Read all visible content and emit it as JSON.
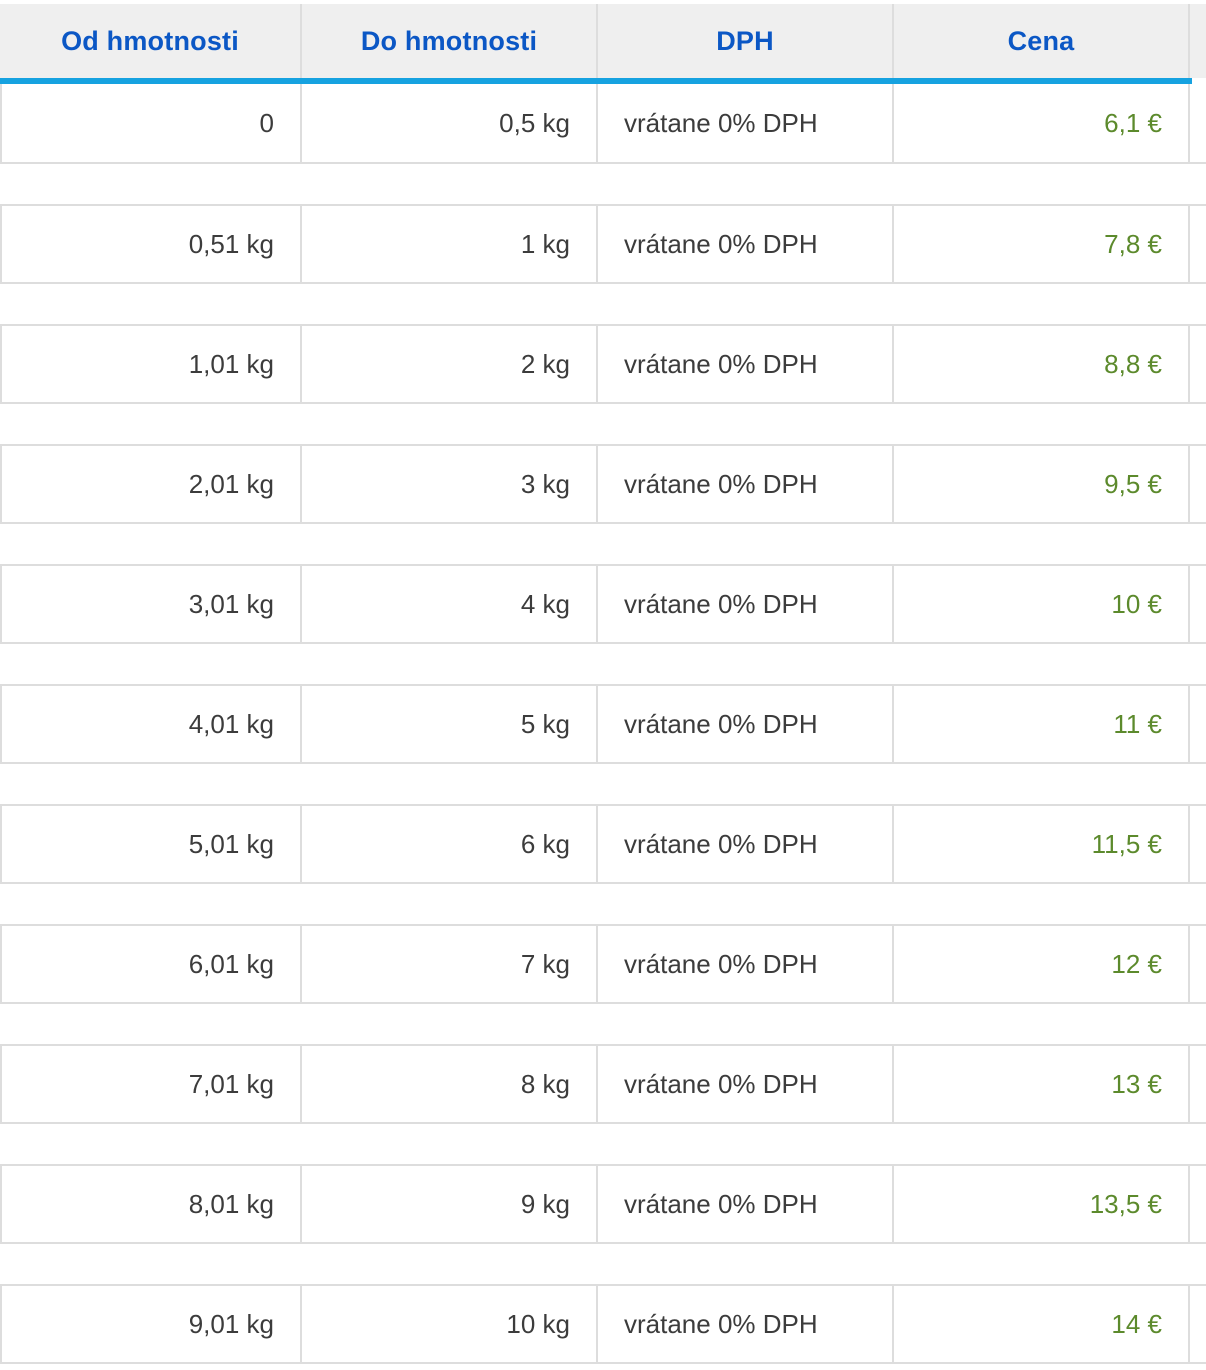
{
  "table": {
    "headers": [
      "Od hmotnosti",
      "Do hmotnosti",
      "DPH",
      "Cena"
    ],
    "rows": [
      {
        "from": "0",
        "to": "0,5 kg",
        "vat": "vrátane 0% DPH",
        "price": "6,1 €"
      },
      {
        "from": "0,51 kg",
        "to": "1 kg",
        "vat": "vrátane 0% DPH",
        "price": "7,8 €"
      },
      {
        "from": "1,01 kg",
        "to": "2 kg",
        "vat": "vrátane 0% DPH",
        "price": "8,8 €"
      },
      {
        "from": "2,01 kg",
        "to": "3 kg",
        "vat": "vrátane 0% DPH",
        "price": "9,5 €"
      },
      {
        "from": "3,01 kg",
        "to": "4 kg",
        "vat": "vrátane 0% DPH",
        "price": "10 €"
      },
      {
        "from": "4,01 kg",
        "to": "5 kg",
        "vat": "vrátane 0% DPH",
        "price": "11 €"
      },
      {
        "from": "5,01 kg",
        "to": "6 kg",
        "vat": "vrátane 0% DPH",
        "price": "11,5 €"
      },
      {
        "from": "6,01 kg",
        "to": "7 kg",
        "vat": "vrátane 0% DPH",
        "price": "12 €"
      },
      {
        "from": "7,01 kg",
        "to": "8 kg",
        "vat": "vrátane 0% DPH",
        "price": "13 €"
      },
      {
        "from": "8,01 kg",
        "to": "9 kg",
        "vat": "vrátane 0% DPH",
        "price": "13,5 €"
      },
      {
        "from": "9,01 kg",
        "to": "10 kg",
        "vat": "vrátane 0% DPH",
        "price": "14 €"
      }
    ]
  },
  "colors": {
    "header_text": "#0b57c5",
    "header_accent_line": "#16a2e0",
    "price_text": "#5c8a2c",
    "body_text": "#3c3c3c",
    "header_bg": "#efefef",
    "border": "#dddddd"
  }
}
